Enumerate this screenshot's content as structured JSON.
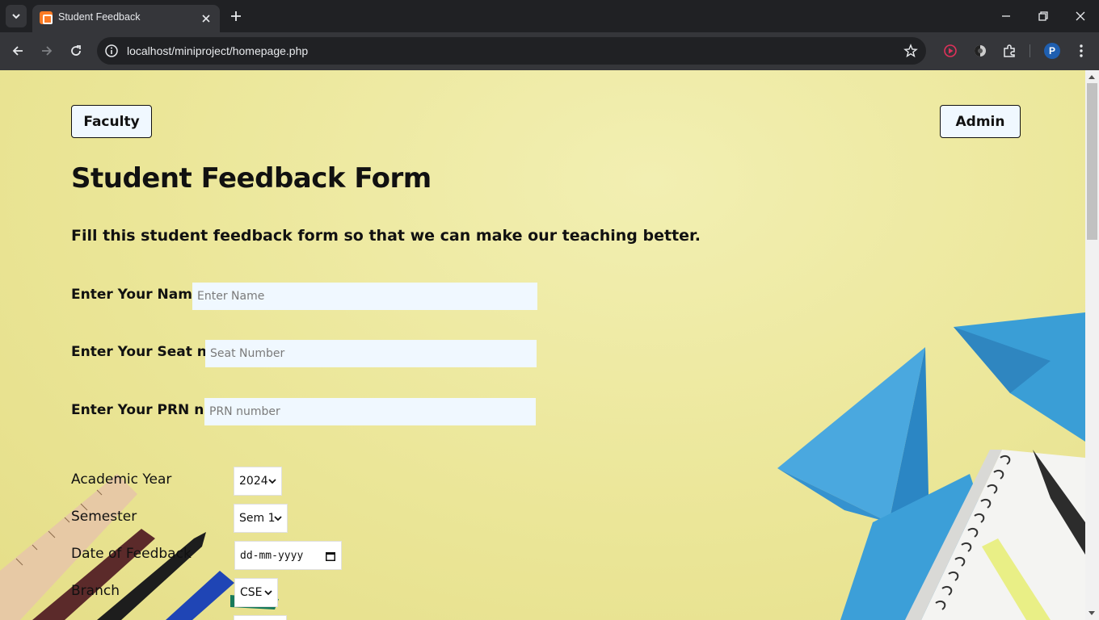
{
  "browser": {
    "tab_title": "Student Feedback",
    "url": "localhost/miniproject/homepage.php",
    "profile_initial": "P"
  },
  "page": {
    "faculty_button": "Faculty",
    "admin_button": "Admin",
    "title": "Student Feedback Form",
    "subtitle": "Fill this student feedback form so that we can make our teaching better.",
    "name": {
      "label": "Enter Your Name:",
      "placeholder": "Enter Name"
    },
    "seat": {
      "label": "Enter Your Seat no:",
      "placeholder": "Seat Number"
    },
    "prn": {
      "label": "Enter Your PRN no:",
      "placeholder": "PRN number"
    },
    "academic_year": {
      "label": "Academic Year",
      "value": "2024"
    },
    "semester": {
      "label": "Semester",
      "value": "Sem 1"
    },
    "date": {
      "label": "Date of Feedback",
      "value": "dd-mm-yyyy"
    },
    "branch": {
      "label": "Branch",
      "value": "CSE"
    }
  },
  "colors": {
    "page_background": "#ebe698",
    "input_background": "#f0f8ff",
    "chrome_dark": "#202124",
    "chrome_toolbar": "#35363a"
  },
  "icons": [
    "tab-search-icon",
    "xampp-favicon-icon",
    "close-icon",
    "plus-icon",
    "minimize-icon",
    "restore-icon",
    "window-close-icon",
    "back-arrow-icon",
    "forward-arrow-icon",
    "reload-icon",
    "site-info-icon",
    "bookmark-star-icon",
    "record-extension-icon",
    "dark-mode-extension-icon",
    "puzzle-extensions-icon",
    "kebab-menu-icon",
    "calendar-icon",
    "chevron-down-icon"
  ]
}
